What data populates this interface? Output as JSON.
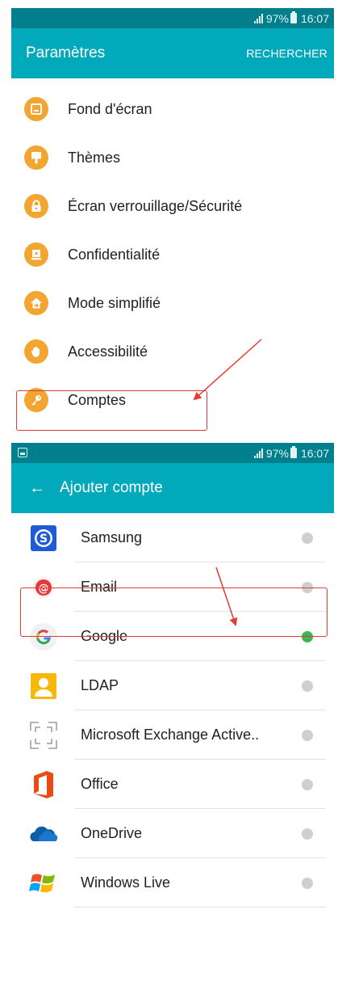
{
  "screen1": {
    "status": {
      "battery": "97%",
      "time": "16:07"
    },
    "appbar": {
      "title": "Paramètres",
      "action": "RECHERCHER"
    },
    "items": [
      {
        "icon": "wallpaper-icon",
        "label": "Fond d'écran"
      },
      {
        "icon": "themes-icon",
        "label": "Thèmes"
      },
      {
        "icon": "lock-icon",
        "label": "Écran verrouillage/Sécurité"
      },
      {
        "icon": "privacy-icon",
        "label": "Confidentialité"
      },
      {
        "icon": "easy-mode-icon",
        "label": "Mode simplifié"
      },
      {
        "icon": "accessibility-icon",
        "label": "Accessibilité"
      },
      {
        "icon": "key-icon",
        "label": "Comptes"
      }
    ],
    "highlighted_item": "Comptes"
  },
  "screen2": {
    "status": {
      "battery": "97%",
      "time": "16:07"
    },
    "appbar": {
      "back": "←",
      "title": "Ajouter compte"
    },
    "accounts": [
      {
        "icon": "samsung-icon",
        "label": "Samsung",
        "active": false
      },
      {
        "icon": "email-icon",
        "label": "Email",
        "active": false
      },
      {
        "icon": "google-icon",
        "label": "Google",
        "active": true
      },
      {
        "icon": "ldap-icon",
        "label": "LDAP",
        "active": false
      },
      {
        "icon": "exchange-icon",
        "label": "Microsoft Exchange Active..",
        "active": false
      },
      {
        "icon": "office-icon",
        "label": "Office",
        "active": false
      },
      {
        "icon": "onedrive-icon",
        "label": "OneDrive",
        "active": false
      },
      {
        "icon": "windows-live-icon",
        "label": "Windows Live",
        "active": false
      }
    ],
    "highlighted_item": "Google"
  },
  "colors": {
    "status_bar": "#017f8d",
    "app_bar": "#02a9ba",
    "settings_icon_bg": "#f2a531",
    "highlight": "#e53935",
    "active_dot": "#3bb652",
    "inactive_dot": "#cfcfcf"
  }
}
